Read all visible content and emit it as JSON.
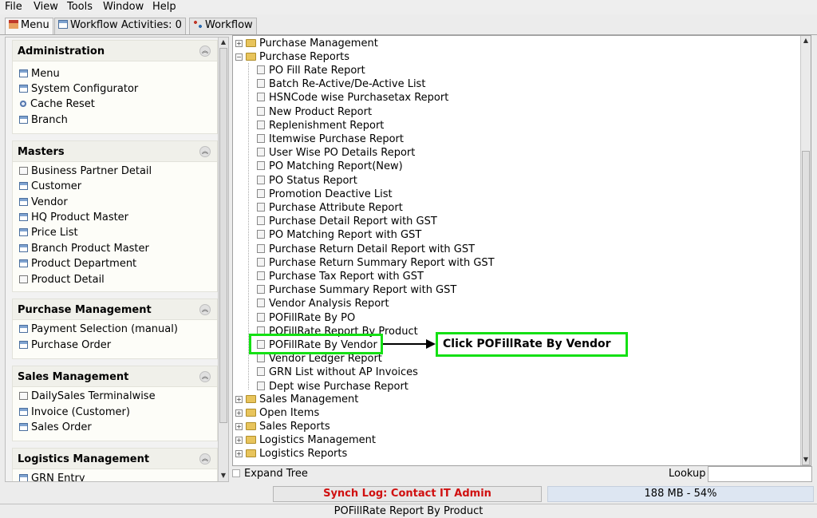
{
  "menubar": [
    "File",
    "View",
    "Tools",
    "Window",
    "Help"
  ],
  "tabs": [
    "Menu",
    "Workflow Activities: 0",
    "Workflow"
  ],
  "sections": [
    {
      "title": "Administration",
      "items": [
        {
          "label": "Menu",
          "icon": "window-icon"
        },
        {
          "label": "System Configurator",
          "icon": "window-icon"
        },
        {
          "label": "Cache Reset",
          "icon": "gear-icon"
        },
        {
          "label": "Branch",
          "icon": "window-icon"
        }
      ]
    },
    {
      "title": "Masters",
      "items": [
        {
          "label": "Business Partner Detail",
          "icon": "document-icon"
        },
        {
          "label": "Customer",
          "icon": "window-icon"
        },
        {
          "label": "Vendor",
          "icon": "window-icon"
        },
        {
          "label": "HQ Product Master",
          "icon": "window-icon"
        },
        {
          "label": "Price List",
          "icon": "window-icon"
        },
        {
          "label": "Branch Product Master",
          "icon": "window-icon"
        },
        {
          "label": "Product Department",
          "icon": "window-icon"
        },
        {
          "label": "Product Detail",
          "icon": "document-icon"
        }
      ]
    },
    {
      "title": "Purchase Management",
      "items": [
        {
          "label": "Payment Selection (manual)",
          "icon": "window-icon"
        },
        {
          "label": "Purchase Order",
          "icon": "window-icon"
        }
      ]
    },
    {
      "title": "Sales Management",
      "items": [
        {
          "label": "DailySales Terminalwise",
          "icon": "document-icon"
        },
        {
          "label": "Invoice (Customer)",
          "icon": "window-icon"
        },
        {
          "label": "Sales Order",
          "icon": "window-icon"
        }
      ]
    },
    {
      "title": "Logistics Management",
      "items": [
        {
          "label": "GRN Entry",
          "icon": "window-icon"
        }
      ]
    }
  ],
  "tree": {
    "top_folders": [
      "Purchase Management"
    ],
    "open_folder": "Purchase Reports",
    "reports": [
      "PO Fill Rate Report",
      "Batch Re-Active/De-Active List",
      "HSNCode wise Purchasetax Report",
      "New Product Report",
      "Replenishment Report",
      "Itemwise Purchase Report",
      "User Wise PO Details Report",
      "PO Matching Report(New)",
      "PO Status Report",
      "Promotion Deactive List",
      "Purchase Attribute Report",
      "Purchase Detail Report with GST",
      "PO Matching Report with GST",
      "Purchase Return Detail Report with GST",
      "Purchase Return Summary Report with GST",
      "Purchase Tax Report with GST",
      "Purchase Summary Report with GST",
      "Vendor Analysis Report",
      "POFillRate By PO",
      "POFillRate Report By Product",
      "POFillRate By Vendor",
      "Vendor Ledger Report",
      "GRN List without AP Invoices",
      "Dept wise Purchase Report"
    ],
    "bottom_folders": [
      "Sales Management",
      "Open Items",
      "Sales Reports",
      "Logistics Management",
      "Logistics Reports"
    ]
  },
  "annotation": {
    "callout_text": "Click POFillRate By Vendor",
    "highlight_color": "#14e014"
  },
  "controls": {
    "expand_tree_label": "Expand Tree",
    "lookup_label": "Lookup",
    "lookup_value": ""
  },
  "status": {
    "synch_log": "Synch Log: Contact IT Admin",
    "memory": "188 MB - 54%",
    "memory_percent": 54,
    "status_text": "POFillRate Report By Product"
  },
  "colors": {
    "synch_text": "#d01010",
    "memory_bar": "#dde6f2"
  }
}
